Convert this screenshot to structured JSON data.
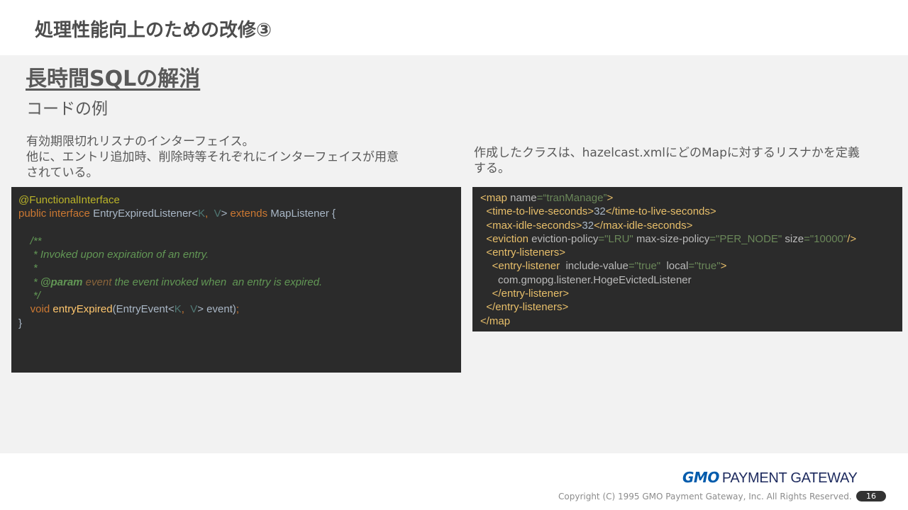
{
  "slide": {
    "title": "処理性能向上のための改修③",
    "heading": "長時間SQLの解消",
    "subheading": "コードの例",
    "left_description": [
      "有効期限切れリスナのインターフェイス。",
      "他に、エントリ追加時、削除時等それぞれにインターフェイスが用意",
      "されている。"
    ],
    "right_description": [
      "作成したクラスは、hazelcast.xmlにどのMapに対するリスナかを定義",
      "する。"
    ]
  },
  "code_java": [
    [
      {
        "t": "@FunctionalInterface",
        "c": "ann"
      }
    ],
    [
      {
        "t": "public ",
        "c": "kw"
      },
      {
        "t": "interface ",
        "c": "kw"
      },
      {
        "t": "EntryExpiredListener<",
        "c": "pl"
      },
      {
        "t": "K",
        "c": "tp"
      },
      {
        "t": ",  ",
        "c": "kw"
      },
      {
        "t": "V",
        "c": "tp"
      },
      {
        "t": "> ",
        "c": "pl"
      },
      {
        "t": "extends ",
        "c": "kw"
      },
      {
        "t": "MapListener {",
        "c": "pl"
      }
    ],
    [
      {
        "t": "",
        "c": "pl"
      }
    ],
    [
      {
        "t": "    /**",
        "c": "cm"
      }
    ],
    [
      {
        "t": "     * Invoked upon expiration of an entry.",
        "c": "cm"
      }
    ],
    [
      {
        "t": "     *",
        "c": "cm"
      }
    ],
    [
      {
        "t": "     * ",
        "c": "cm"
      },
      {
        "t": "@param ",
        "c": "cm-tag"
      },
      {
        "t": "event ",
        "c": "cm-param"
      },
      {
        "t": "the event invoked when  an entry is expired.",
        "c": "cm"
      }
    ],
    [
      {
        "t": "     */",
        "c": "cm"
      }
    ],
    [
      {
        "t": "    void ",
        "c": "kw"
      },
      {
        "t": "entryExpired",
        "c": "fn"
      },
      {
        "t": "(EntryEvent<",
        "c": "pl"
      },
      {
        "t": "K",
        "c": "tp"
      },
      {
        "t": ",  ",
        "c": "kw"
      },
      {
        "t": "V",
        "c": "tp"
      },
      {
        "t": "> event)",
        "c": "pl"
      },
      {
        "t": ";",
        "c": "kw"
      }
    ],
    [
      {
        "t": "}",
        "c": "pl"
      }
    ]
  ],
  "code_xml": [
    [
      {
        "t": "<map ",
        "c": "xt"
      },
      {
        "t": "name",
        "c": "xa"
      },
      {
        "t": "=“tranManage”",
        "c": "xv"
      },
      {
        "t": ">",
        "c": "xt"
      }
    ],
    [
      {
        "t": "  <time-to-live-seconds>",
        "c": "xt"
      },
      {
        "t": "32",
        "c": "pl"
      },
      {
        "t": "</time-to-live-seconds>",
        "c": "xt"
      }
    ],
    [
      {
        "t": "  <max-idle-seconds>",
        "c": "xt"
      },
      {
        "t": "32",
        "c": "pl"
      },
      {
        "t": "</max-idle-seconds>",
        "c": "xt"
      }
    ],
    [
      {
        "t": "  <eviction ",
        "c": "xt"
      },
      {
        "t": "eviction-policy",
        "c": "xa"
      },
      {
        "t": "=\"LRU\" ",
        "c": "xv"
      },
      {
        "t": "max-size-policy",
        "c": "xa"
      },
      {
        "t": "=\"PER_NODE\" ",
        "c": "xv"
      },
      {
        "t": "size",
        "c": "xa"
      },
      {
        "t": "=\"10000\"",
        "c": "xv"
      },
      {
        "t": "/>",
        "c": "xt"
      }
    ],
    [
      {
        "t": "  <entry-listeners>",
        "c": "xt"
      }
    ],
    [
      {
        "t": "    <entry-listener  ",
        "c": "xt"
      },
      {
        "t": "include-value",
        "c": "xa"
      },
      {
        "t": "=\"true\"  ",
        "c": "xv"
      },
      {
        "t": "local",
        "c": "xa"
      },
      {
        "t": "=\"true\"",
        "c": "xv"
      },
      {
        "t": ">",
        "c": "xt"
      }
    ],
    [
      {
        "t": "      com.gmopg.listener.HogeEvictedListener",
        "c": "xa"
      }
    ],
    [
      {
        "t": "    </entry-listener>",
        "c": "xt"
      }
    ],
    [
      {
        "t": "  </entry-listeners>",
        "c": "xt"
      }
    ],
    [
      {
        "t": "</map",
        "c": "xt"
      }
    ]
  ],
  "footer": {
    "logo_gmo": "GMO",
    "logo_text": "PAYMENT GATEWAY",
    "copyright": "Copyright (C) 1995 GMO Payment Gateway, Inc. All Rights Reserved.",
    "page_number": "16"
  }
}
